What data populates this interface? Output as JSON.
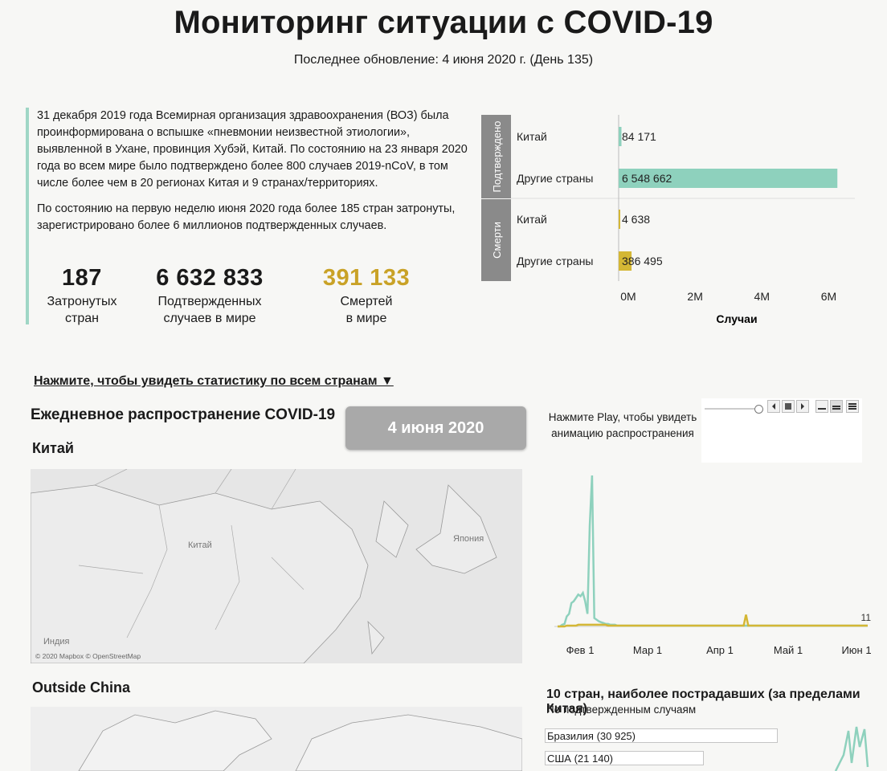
{
  "header": {
    "title": "Мониторинг ситуации с COVID-19",
    "subtitle": "Последнее обновление: 4 июня 2020 г. (День 135)"
  },
  "intro": {
    "paragraph1": "31 декабря 2019 года Всемирная организация здравоохранения (ВОЗ) была проинформирована о вспышке «пневмонии неизвестной этиологии», выявленной в Ухане, провинция Хубэй, Китай. По состоянию на 23 января 2020 года во всем мире было подтверждено более 800 случаев 2019-nCoV, в том числе более чем в 20 регионах Китая и 9 странах/территориях.",
    "paragraph2": "По состоянию на первую неделю июня 2020 года более 185 стран затронуты, зарегистрировано более 6 миллионов подтвержденных случаев."
  },
  "stats": [
    {
      "value": "187",
      "label1": "Затронутых",
      "label2": "стран",
      "color": "#1a1a1a"
    },
    {
      "value": "6 632 833",
      "label1": "Подтвержденных",
      "label2": "случаев в мире",
      "color": "#1a1a1a"
    },
    {
      "value": "391 133",
      "label1": "Смертей",
      "label2": "в мире",
      "color": "#c9a227"
    }
  ],
  "chart_data": [
    {
      "type": "bar",
      "xlabel": "Случаи",
      "xlim": [
        0,
        7000000
      ],
      "ticks": [
        "0M",
        "2M",
        "4M",
        "6M"
      ],
      "tick_values": [
        0,
        2000000,
        4000000,
        6000000
      ],
      "groups": [
        {
          "name": "Подтверждено",
          "color": "#8ed1bd",
          "categories": [
            "Китай",
            "Другие страны"
          ],
          "values": [
            84171,
            6548662
          ],
          "labels": [
            "84 171",
            "6 548 662"
          ]
        },
        {
          "name": "Смерти",
          "color": "#d4b735",
          "categories": [
            "Китай",
            "Другие страны"
          ],
          "values": [
            4638,
            386495
          ],
          "labels": [
            "4 638",
            "386 495"
          ]
        }
      ]
    },
    {
      "type": "line",
      "ticks": [
        "Фев 1",
        "Мар 1",
        "Апр 1",
        "Май 1",
        "Июн 1"
      ],
      "end_label": "11",
      "series": [
        {
          "color": "#8ed1bd",
          "values": [
            0,
            0,
            2,
            3,
            12,
            15,
            28,
            30,
            34,
            38,
            36,
            40,
            30,
            15,
            120,
            180,
            10,
            8,
            6,
            5,
            4,
            3,
            3,
            2,
            2,
            2,
            1,
            1,
            1,
            1,
            1,
            1,
            1,
            1,
            1,
            1,
            1,
            1,
            1,
            1,
            1,
            1,
            1,
            1,
            1,
            1,
            1,
            1,
            1,
            1,
            1,
            1,
            1,
            1,
            1,
            1,
            1,
            1,
            1,
            1,
            1,
            1,
            1,
            1,
            1,
            1,
            1,
            1,
            1,
            1,
            1,
            1,
            1,
            1,
            1,
            1,
            1,
            1,
            1,
            1,
            1,
            1,
            1,
            1,
            1,
            1,
            1,
            1,
            1,
            1,
            1,
            1,
            1,
            1,
            1,
            1,
            1,
            1,
            1,
            1,
            1,
            1,
            1,
            1,
            1,
            1,
            1,
            1,
            1,
            1,
            1,
            1,
            1,
            1,
            1,
            1,
            1,
            1,
            1,
            1,
            1,
            1,
            1,
            1,
            1,
            1,
            1,
            1,
            1,
            1,
            1,
            1,
            1,
            1,
            1,
            1
          ]
        },
        {
          "color": "#d4b735",
          "values": [
            0,
            0,
            0,
            0,
            1,
            1,
            1,
            1,
            1,
            2,
            2,
            2,
            2,
            2,
            2,
            2,
            2,
            2,
            2,
            2,
            2,
            2,
            1,
            1,
            1,
            1,
            1,
            1,
            1,
            1,
            1,
            1,
            1,
            1,
            1,
            1,
            1,
            1,
            1,
            1,
            1,
            1,
            1,
            1,
            1,
            1,
            1,
            1,
            1,
            1,
            1,
            1,
            1,
            1,
            1,
            1,
            1,
            1,
            1,
            1,
            1,
            1,
            1,
            1,
            1,
            1,
            1,
            1,
            1,
            1,
            1,
            1,
            1,
            1,
            1,
            1,
            1,
            1,
            1,
            1,
            1,
            1,
            14,
            1,
            1,
            1,
            1,
            1,
            1,
            1,
            1,
            1,
            1,
            1,
            1,
            1,
            1,
            1,
            1,
            1,
            1,
            1,
            1,
            1,
            1,
            1,
            1,
            1,
            1,
            1,
            1,
            1,
            1,
            1,
            1,
            1,
            1,
            1,
            1,
            1,
            1,
            1,
            1,
            1,
            1,
            1,
            1,
            1,
            1,
            1,
            1,
            1,
            1,
            1,
            1,
            1
          ]
        }
      ]
    },
    {
      "type": "bar",
      "title": "10 стран, наиболее пострадавших (за пределами Китая)",
      "subtitle": "По подтвержденным случаям",
      "categories": [
        "Бразилия (30 925)",
        "США (21 140)"
      ],
      "values": [
        30925,
        21140
      ]
    }
  ],
  "daily": {
    "heading": "Ежедневное распространение COVID-19",
    "date": "4 июня 2020",
    "china_label": "Китай",
    "outside_label": "Outside China",
    "play_hint": "Нажмите Play, чтобы увидеть анимацию распространения",
    "link": "Нажмите, чтобы увидеть статистику по всем странам ▼"
  },
  "map": {
    "labels": {
      "china": "Китай",
      "japan": "Япония",
      "india": "Индия"
    },
    "attribution": "© 2020 Mapbox © OpenStreetMap"
  },
  "icons": [
    "slider-knob-icon",
    "prev-icon",
    "stop-icon",
    "next-icon",
    "speed-slow-icon",
    "speed-medium-icon",
    "speed-fast-icon",
    "triangle-down-icon"
  ]
}
